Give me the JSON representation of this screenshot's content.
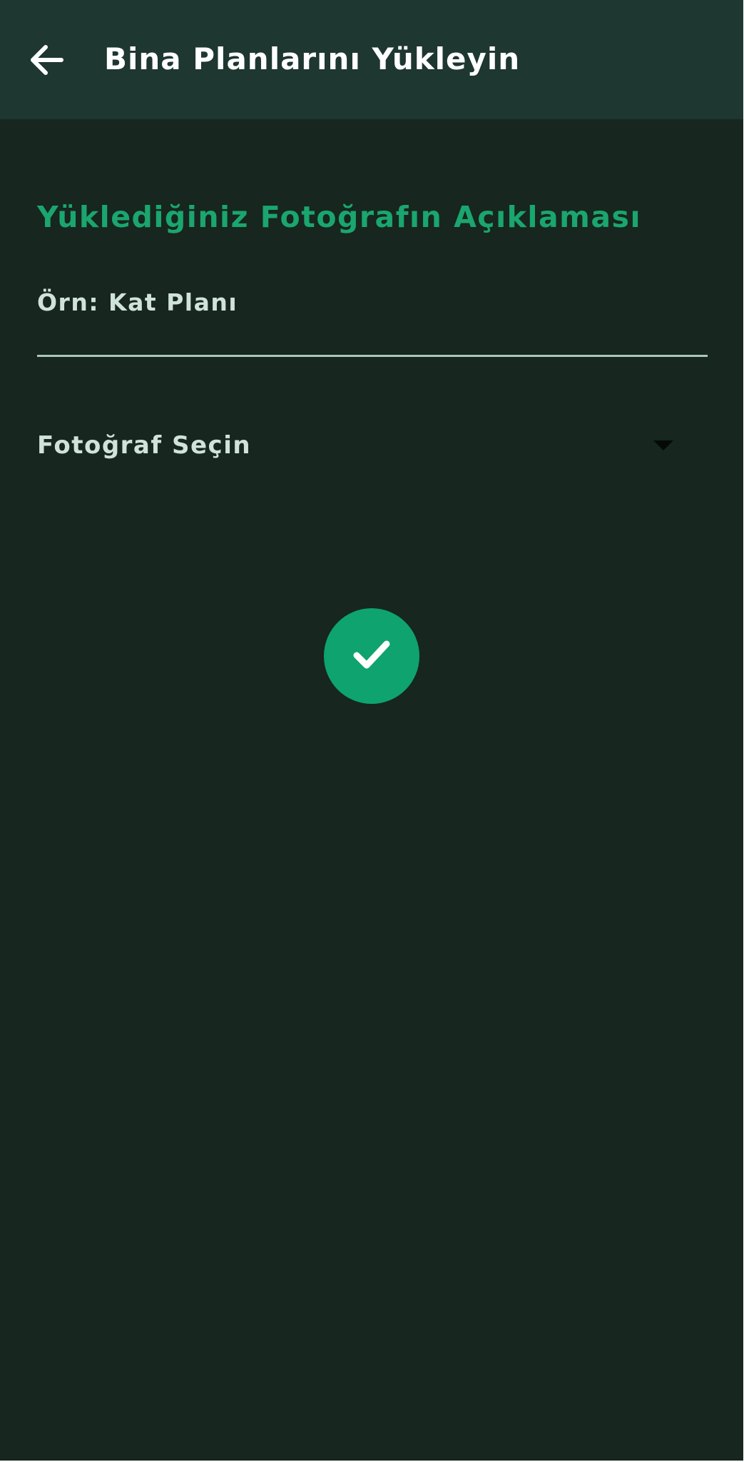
{
  "app_bar": {
    "title": "Bina Planlarını Yükleyin",
    "back_icon": "arrow-left-icon",
    "background_color": "#1e3730"
  },
  "form": {
    "section_title": "Yüklediğiniz Fotoğrafın Açıklaması",
    "description_input": {
      "placeholder": "Örn: Kat Planı",
      "value": ""
    },
    "photo_dropdown": {
      "label": "Fotoğraf Seçin",
      "arrow_icon": "caret-down-icon"
    },
    "confirm_button": {
      "icon": "check-icon",
      "color": "#0ea36f"
    }
  },
  "colors": {
    "background": "#17261f",
    "accent": "#1aa66e",
    "text": "#cfe3da"
  }
}
